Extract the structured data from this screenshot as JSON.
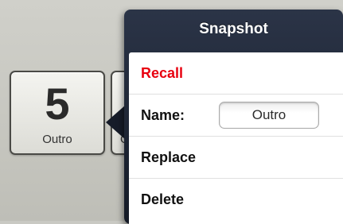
{
  "snapshot_pad": {
    "number": "5",
    "name": "Outro"
  },
  "next_pad": {
    "partial_label": "O"
  },
  "popover": {
    "title": "Snapshot",
    "recall_label": "Recall",
    "name_label": "Name:",
    "name_value": "Outro",
    "replace_label": "Replace",
    "delete_label": "Delete"
  },
  "colors": {
    "recall": "#e8000f",
    "popover_header": "#1e2535",
    "background": "#c9c9c3"
  }
}
